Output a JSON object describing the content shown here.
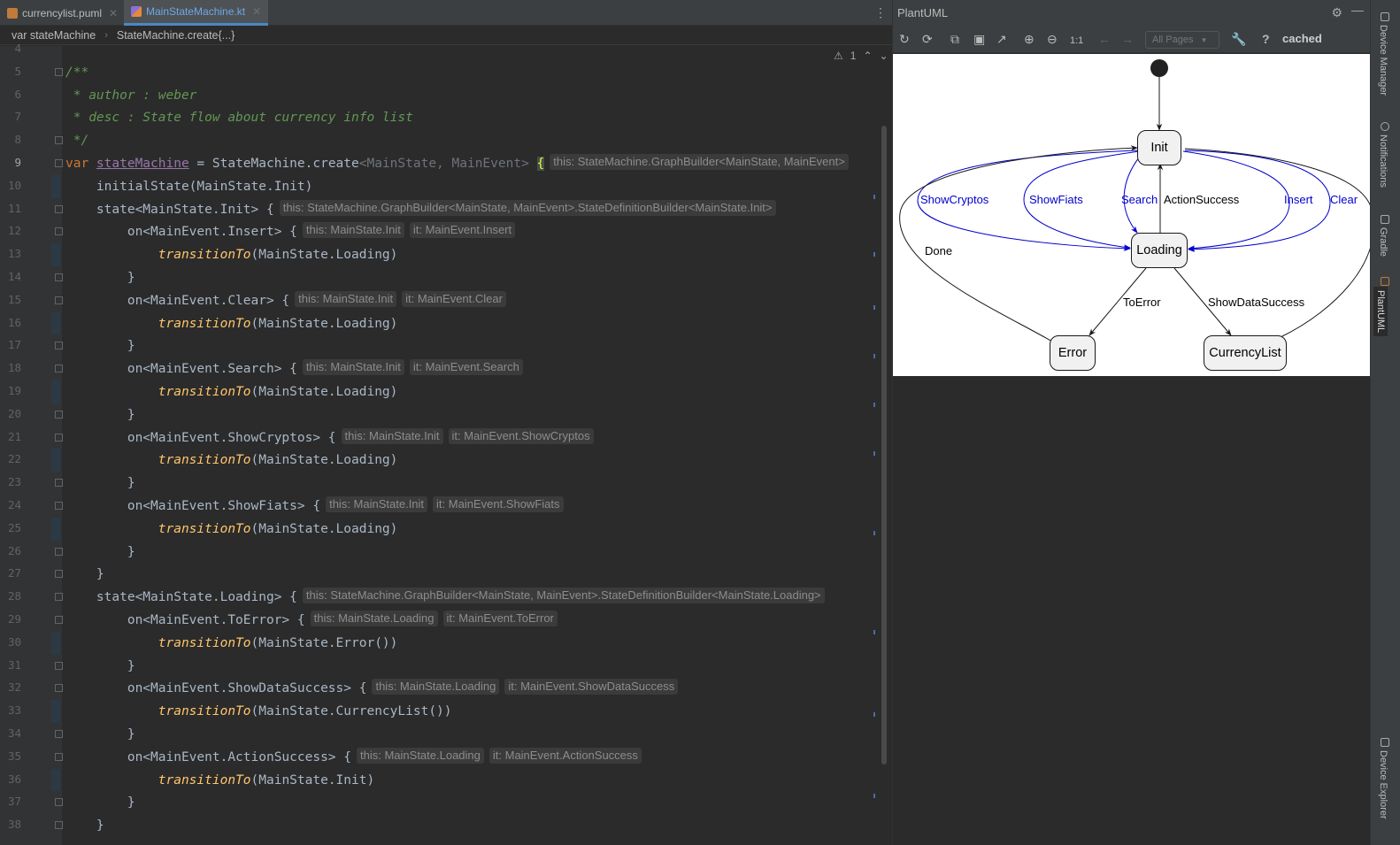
{
  "tabs": [
    {
      "label": "currencylist.puml",
      "active": false
    },
    {
      "label": "MainStateMachine.kt",
      "active": true
    }
  ],
  "breadcrumb": [
    "var stateMachine",
    "StateMachine.create{...}"
  ],
  "editor": {
    "line_numbers": [
      "4",
      "5",
      "6",
      "7",
      "8",
      "9",
      "10",
      "11",
      "12",
      "13",
      "14",
      "15",
      "16",
      "17",
      "18",
      "19",
      "20",
      "21",
      "22",
      "23",
      "24",
      "25",
      "26",
      "27",
      "28",
      "29",
      "30",
      "31",
      "32",
      "33",
      "34",
      "35",
      "36",
      "37",
      "38"
    ],
    "current_line": "9",
    "warnings": {
      "count": "1"
    },
    "lines": [
      {
        "n": 5,
        "segs": [
          [
            "cm",
            "/**"
          ]
        ]
      },
      {
        "n": 6,
        "segs": [
          [
            "cm",
            " * author : weber"
          ]
        ]
      },
      {
        "n": 7,
        "segs": [
          [
            "cm",
            " * desc : State flow about currency info list"
          ]
        ]
      },
      {
        "n": 8,
        "segs": [
          [
            "cm",
            " */"
          ]
        ]
      },
      {
        "n": 9,
        "segs": [
          [
            "kw",
            "var "
          ],
          [
            "pr",
            "stateMachine"
          ],
          [
            "df",
            " = StateMachine.create"
          ],
          [
            "gen",
            "<MainState, MainEvent>"
          ],
          [
            "df",
            " "
          ],
          [
            "brace",
            "{"
          ]
        ],
        "hint": [
          "this: StateMachine.GraphBuilder<MainState, MainEvent>"
        ]
      },
      {
        "n": 10,
        "segs": [
          [
            "df",
            "    initialState(MainState.Init)"
          ]
        ]
      },
      {
        "n": 11,
        "segs": [
          [
            "df",
            "    state<MainState.Init> {"
          ]
        ],
        "hint": [
          "this: StateMachine.GraphBuilder<MainState, MainEvent>.StateDefinitionBuilder<MainState.Init>"
        ]
      },
      {
        "n": 12,
        "segs": [
          [
            "df",
            "        on<MainEvent.Insert> {"
          ]
        ],
        "hint": [
          "this: MainState.Init",
          "it: MainEvent.Insert"
        ]
      },
      {
        "n": 13,
        "segs": [
          [
            "df",
            "            "
          ],
          [
            "fn",
            "transitionTo"
          ],
          [
            "df",
            "(MainState.Loading)"
          ]
        ]
      },
      {
        "n": 14,
        "segs": [
          [
            "df",
            "        }"
          ]
        ]
      },
      {
        "n": 15,
        "segs": [
          [
            "df",
            "        on<MainEvent.Clear> {"
          ]
        ],
        "hint": [
          "this: MainState.Init",
          "it: MainEvent.Clear"
        ]
      },
      {
        "n": 16,
        "segs": [
          [
            "df",
            "            "
          ],
          [
            "fn",
            "transitionTo"
          ],
          [
            "df",
            "(MainState.Loading)"
          ]
        ]
      },
      {
        "n": 17,
        "segs": [
          [
            "df",
            "        }"
          ]
        ]
      },
      {
        "n": 18,
        "segs": [
          [
            "df",
            "        on<MainEvent.Search> {"
          ]
        ],
        "hint": [
          "this: MainState.Init",
          "it: MainEvent.Search"
        ]
      },
      {
        "n": 19,
        "segs": [
          [
            "df",
            "            "
          ],
          [
            "fn",
            "transitionTo"
          ],
          [
            "df",
            "(MainState.Loading)"
          ]
        ]
      },
      {
        "n": 20,
        "segs": [
          [
            "df",
            "        }"
          ]
        ]
      },
      {
        "n": 21,
        "segs": [
          [
            "df",
            "        on<MainEvent.ShowCryptos> {"
          ]
        ],
        "hint": [
          "this: MainState.Init",
          "it: MainEvent.ShowCryptos"
        ]
      },
      {
        "n": 22,
        "segs": [
          [
            "df",
            "            "
          ],
          [
            "fn",
            "transitionTo"
          ],
          [
            "df",
            "(MainState.Loading)"
          ]
        ]
      },
      {
        "n": 23,
        "segs": [
          [
            "df",
            "        }"
          ]
        ]
      },
      {
        "n": 24,
        "segs": [
          [
            "df",
            "        on<MainEvent.ShowFiats> {"
          ]
        ],
        "hint": [
          "this: MainState.Init",
          "it: MainEvent.ShowFiats"
        ]
      },
      {
        "n": 25,
        "segs": [
          [
            "df",
            "            "
          ],
          [
            "fn",
            "transitionTo"
          ],
          [
            "df",
            "(MainState.Loading)"
          ]
        ]
      },
      {
        "n": 26,
        "segs": [
          [
            "df",
            "        }"
          ]
        ]
      },
      {
        "n": 27,
        "segs": [
          [
            "df",
            "    }"
          ]
        ]
      },
      {
        "n": 28,
        "segs": [
          [
            "df",
            "    state<MainState.Loading> {"
          ]
        ],
        "hint": [
          "this: StateMachine.GraphBuilder<MainState, MainEvent>.StateDefinitionBuilder<MainState.Loading>"
        ]
      },
      {
        "n": 29,
        "segs": [
          [
            "df",
            "        on<MainEvent.ToError> {"
          ]
        ],
        "hint": [
          "this: MainState.Loading",
          "it: MainEvent.ToError"
        ]
      },
      {
        "n": 30,
        "segs": [
          [
            "df",
            "            "
          ],
          [
            "fn",
            "transitionTo"
          ],
          [
            "df",
            "(MainState.Error())"
          ]
        ]
      },
      {
        "n": 31,
        "segs": [
          [
            "df",
            "        }"
          ]
        ]
      },
      {
        "n": 32,
        "segs": [
          [
            "df",
            "        on<MainEvent.ShowDataSuccess> {"
          ]
        ],
        "hint": [
          "this: MainState.Loading",
          "it: MainEvent.ShowDataSuccess"
        ]
      },
      {
        "n": 33,
        "segs": [
          [
            "df",
            "            "
          ],
          [
            "fn",
            "transitionTo"
          ],
          [
            "df",
            "(MainState.CurrencyList())"
          ]
        ]
      },
      {
        "n": 34,
        "segs": [
          [
            "df",
            "        }"
          ]
        ]
      },
      {
        "n": 35,
        "segs": [
          [
            "df",
            "        on<MainEvent.ActionSuccess> {"
          ]
        ],
        "hint": [
          "this: MainState.Loading",
          "it: MainEvent.ActionSuccess"
        ]
      },
      {
        "n": 36,
        "segs": [
          [
            "df",
            "            "
          ],
          [
            "fn",
            "transitionTo"
          ],
          [
            "df",
            "(MainState.Init)"
          ]
        ]
      },
      {
        "n": 37,
        "segs": [
          [
            "df",
            "        }"
          ]
        ]
      },
      {
        "n": 38,
        "segs": [
          [
            "df",
            "    }"
          ]
        ]
      }
    ]
  },
  "plantuml": {
    "title": "PlantUML",
    "pages_select": "All Pages",
    "zoom_actual": "1:1",
    "help": "?",
    "status": "cached",
    "states": {
      "init": "Init",
      "loading": "Loading",
      "error": "Error",
      "currency_list": "CurrencyList"
    },
    "transitions": {
      "show_cryptos": "ShowCryptos",
      "show_fiats": "ShowFiats",
      "search": "Search",
      "action_success": "ActionSuccess",
      "insert": "Insert",
      "clear": "Clear",
      "done": "Done",
      "to_error": "ToError",
      "show_data_success": "ShowDataSuccess"
    },
    "colors": {
      "event_edge": "#0000cc",
      "flow_edge": "#181818"
    }
  },
  "tool_windows": {
    "device_manager": "Device Manager",
    "notifications": "Notifications",
    "gradle": "Gradle",
    "plantuml": "PlantUML",
    "device_explorer": "Device Explorer"
  }
}
